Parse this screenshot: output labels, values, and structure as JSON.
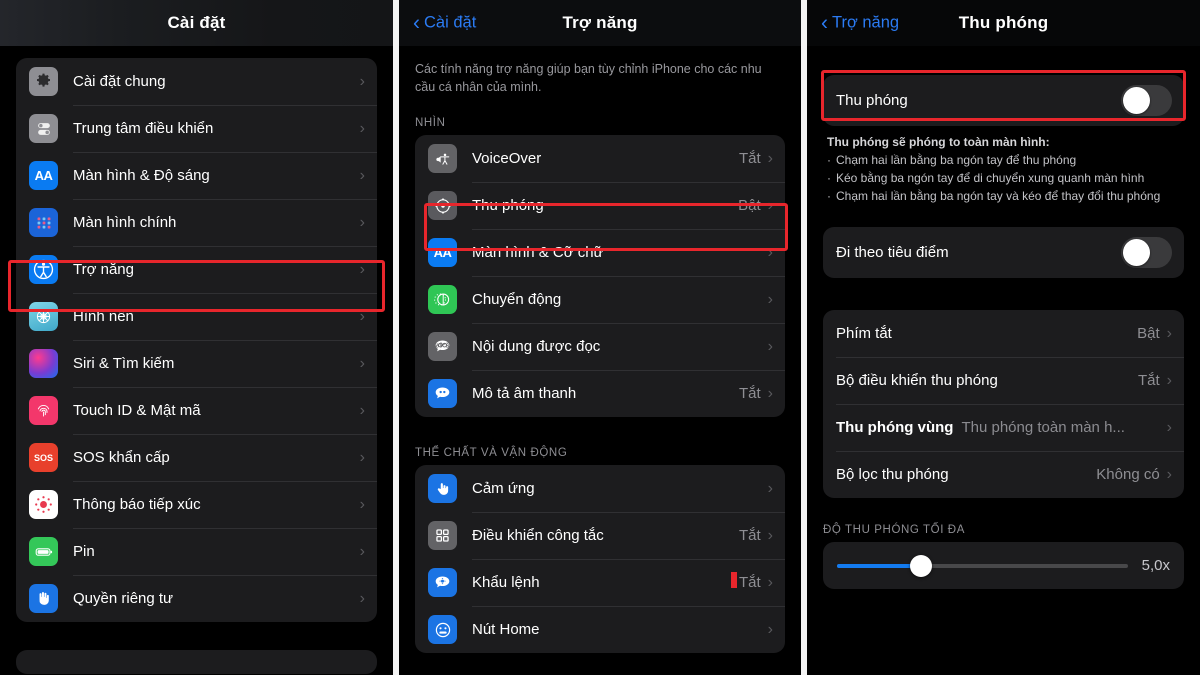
{
  "panels": {
    "settings": {
      "nav": {
        "title": "Cài đặt"
      },
      "groups": [
        {
          "rows": [
            {
              "icon": "gear-icon",
              "label": "Cài đặt chung",
              "value": "",
              "chevron": "›"
            },
            {
              "icon": "control-center-icon",
              "label": "Trung tâm điều khiển",
              "value": "",
              "chevron": "›"
            },
            {
              "icon": "display-brightness-icon",
              "label": "Màn hình & Độ sáng",
              "value": "",
              "chevron": "›"
            },
            {
              "icon": "home-screen-icon",
              "label": "Màn hình chính",
              "value": "",
              "chevron": "›"
            },
            {
              "icon": "accessibility-icon",
              "label": "Trợ năng",
              "value": "",
              "chevron": "›"
            },
            {
              "icon": "wallpaper-icon",
              "label": "Hình nền",
              "value": "",
              "chevron": "›"
            },
            {
              "icon": "siri-icon",
              "label": "Siri & Tìm kiếm",
              "value": "",
              "chevron": "›"
            },
            {
              "icon": "touch-id-icon",
              "label": "Touch ID & Mật mã",
              "value": "",
              "chevron": "›"
            },
            {
              "icon": "sos-icon",
              "label": "SOS khẩn cấp",
              "value": "",
              "chevron": "›"
            },
            {
              "icon": "exposure-notification-icon",
              "label": "Thông báo tiếp xúc",
              "value": "",
              "chevron": "›"
            },
            {
              "icon": "battery-icon",
              "label": "Pin",
              "value": "",
              "chevron": "›"
            },
            {
              "icon": "privacy-icon",
              "label": "Quyền riêng tư",
              "value": "",
              "chevron": "›"
            }
          ]
        }
      ]
    },
    "accessibility": {
      "nav": {
        "back": "Cài đặt",
        "title": "Trợ năng"
      },
      "blurb": "Các tính năng trợ năng giúp bạn tùy chỉnh iPhone cho các nhu cầu cá nhân của mình.",
      "section_vision": "NHÌN",
      "vision_rows": [
        {
          "icon": "voiceover-icon",
          "label": "VoiceOver",
          "value": "Tắt",
          "chevron": "›"
        },
        {
          "icon": "zoom-icon",
          "label": "Thu phóng",
          "value": "Bật",
          "chevron": "›"
        },
        {
          "icon": "display-text-size-icon",
          "label": "Màn hình & Cỡ chữ",
          "value": "",
          "chevron": "›"
        },
        {
          "icon": "motion-icon",
          "label": "Chuyển động",
          "value": "",
          "chevron": "›"
        },
        {
          "icon": "spoken-content-icon",
          "label": "Nội dung được đọc",
          "value": "",
          "chevron": "›"
        },
        {
          "icon": "audio-descriptions-icon",
          "label": "Mô tả âm thanh",
          "value": "Tắt",
          "chevron": "›"
        }
      ],
      "section_physical": "THỂ CHẤT VÀ VẬN ĐỘNG",
      "physical_rows": [
        {
          "icon": "touch-icon",
          "label": "Cảm ứng",
          "value": "",
          "chevron": "›"
        },
        {
          "icon": "switch-control-icon",
          "label": "Điều khiển công tắc",
          "value": "Tắt",
          "chevron": "›"
        },
        {
          "icon": "voice-control-icon",
          "label": "Khẩu lệnh",
          "value": "Tắt",
          "chevron": "›"
        },
        {
          "icon": "home-button-icon",
          "label": "Nút Home",
          "value": "",
          "chevron": "›"
        }
      ]
    },
    "zoom": {
      "nav": {
        "back": "Trợ năng",
        "title": "Thu phóng"
      },
      "toggle_row": {
        "label": "Thu phóng",
        "state": "off"
      },
      "description": {
        "heading": "Thu phóng sẽ phóng to toàn màn hình:",
        "bullets": [
          "Chạm hai lần bằng ba ngón tay để thu phóng",
          "Kéo bằng ba ngón tay để di chuyển xung quanh màn hình",
          "Chạm hai lần bằng ba ngón tay và kéo để thay đổi thu phóng"
        ]
      },
      "follow_focus": {
        "label": "Đi theo tiêu điểm",
        "state": "off"
      },
      "option_rows": [
        {
          "label": "Phím tắt",
          "value": "Bật",
          "chevron": "›",
          "bold": false
        },
        {
          "label": "Bộ điều khiển thu phóng",
          "value": "Tắt",
          "chevron": "›",
          "bold": false
        },
        {
          "label": "Thu phóng vùng",
          "value": "Thu phóng toàn màn h...",
          "chevron": "›",
          "bold": true
        },
        {
          "label": "Bộ lọc thu phóng",
          "value": "Không có",
          "chevron": "›",
          "bold": false
        }
      ],
      "max_zoom": {
        "section": "ĐỘ THU PHÓNG TỐI ĐA",
        "value": "5,0x",
        "fill_percent": 29
      }
    }
  },
  "highlights": {
    "accent_color": "#e8262c"
  }
}
